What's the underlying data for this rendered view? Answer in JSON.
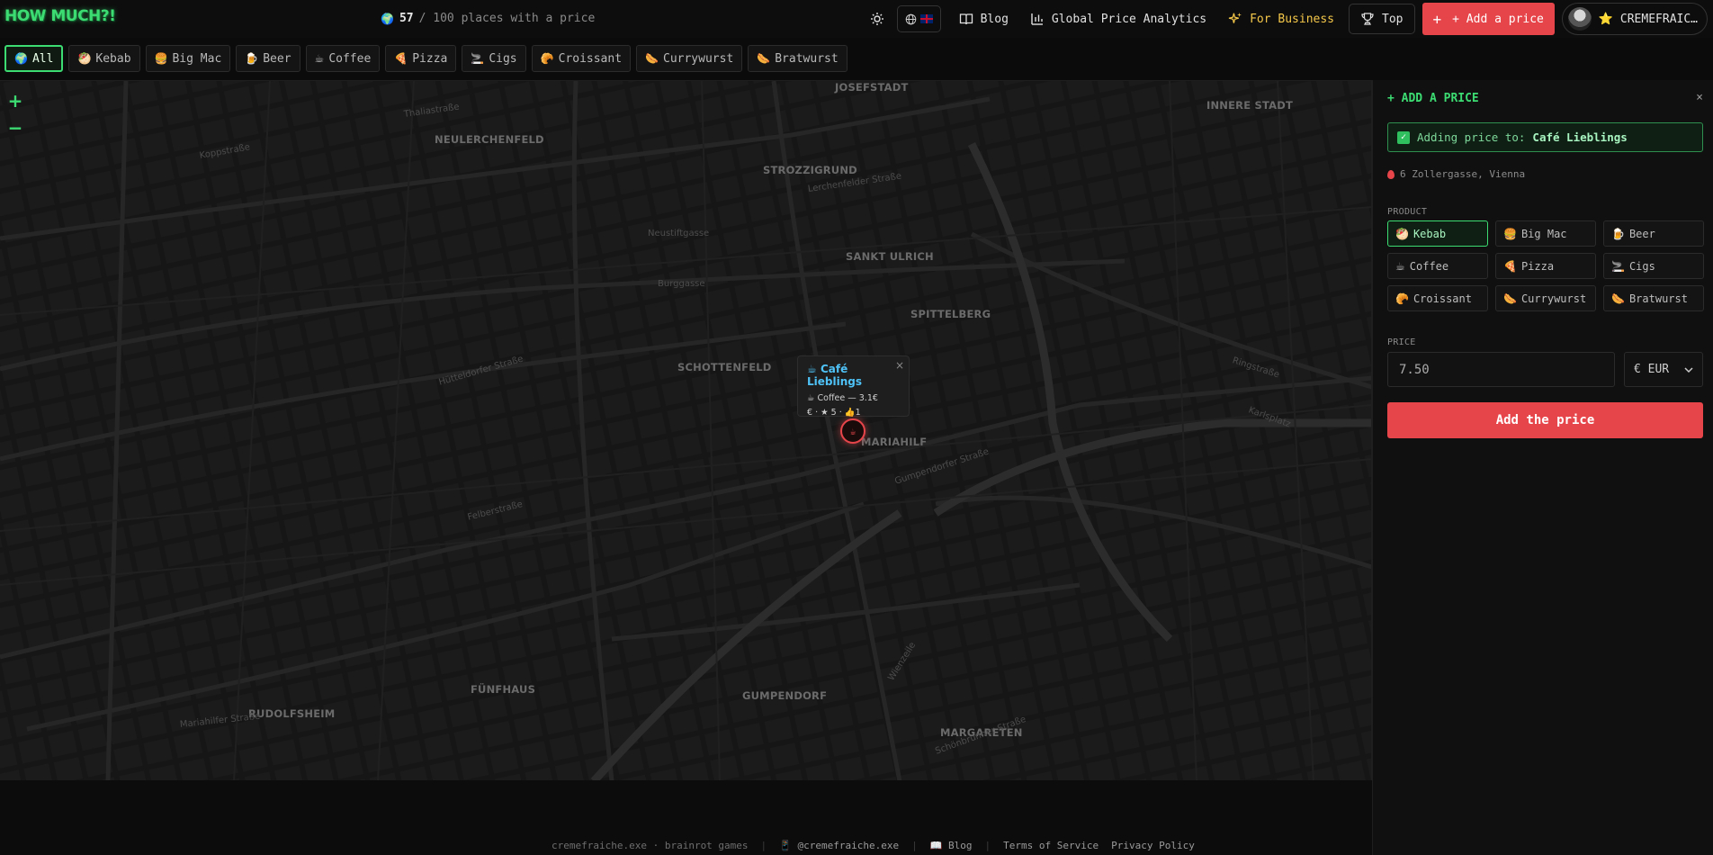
{
  "header": {
    "logo": "HOW MUCH?!",
    "counter_icon": "globe-emoji",
    "counter_value": "57",
    "counter_text": "/ 100 places with a price",
    "theme_icon": "sun-icon",
    "lang_icon": "globe-icon",
    "lang_flag": "uk-flag",
    "nav_blog": "Blog",
    "nav_analytics": "Global Price Analytics",
    "nav_business": "For Business",
    "nav_top": "Top",
    "add_price": "+ Add a price",
    "user_name": "⭐ CREMEFRAIC…"
  },
  "filters": [
    {
      "emoji": "🌍",
      "label": "All",
      "active": true
    },
    {
      "emoji": "🥙",
      "label": "Kebab"
    },
    {
      "emoji": "🍔",
      "label": "Big Mac"
    },
    {
      "emoji": "🍺",
      "label": "Beer"
    },
    {
      "emoji": "☕",
      "label": "Coffee"
    },
    {
      "emoji": "🍕",
      "label": "Pizza"
    },
    {
      "emoji": "🚬",
      "label": "Cigs"
    },
    {
      "emoji": "🥐",
      "label": "Croissant"
    },
    {
      "emoji": "🌭",
      "label": "Currywurst"
    },
    {
      "emoji": "🌭",
      "label": "Bratwurst"
    }
  ],
  "map": {
    "zoom_in": "+",
    "zoom_out": "−",
    "districts": [
      "JOSEFSTADT",
      "INNERE STADT",
      "NEULERCHENFELD",
      "STROZZIGRUND",
      "SANKT ULRICH",
      "SPITTELBERG",
      "SCHOTTENFELD",
      "MARIAHILF",
      "FÜNFHAUS",
      "RUDOLFSHEIM",
      "GUMPENDORF",
      "MARGARETEN"
    ],
    "streets": [
      "Thaliastraße",
      "Koppstraße",
      "Lerchenfelder Straße",
      "Neustiftgasse",
      "Burggasse",
      "Hütteldorfer Straße",
      "Felberstraße",
      "Gumpendorfer Straße",
      "Mariahilfer Straße",
      "Wienzeile",
      "Ringstraße",
      "Karlsplatz",
      "Schönbrunner Straße"
    ],
    "popup": {
      "title": "Café Lieblings",
      "title_emoji": "☕",
      "line1": "☕ Coffee — 3.1€",
      "line2": "€ · ★ 5 · 👍1",
      "close": "×"
    },
    "pin_label": "☕"
  },
  "panel": {
    "title": "+ ADD A PRICE",
    "close": "×",
    "adding_label": "Adding price to:",
    "adding_place": "Café Lieblings",
    "address": "6 Zollergasse, Vienna",
    "product_label": "PRODUCT",
    "products": [
      {
        "emoji": "🥙",
        "label": "Kebab",
        "active": true
      },
      {
        "emoji": "🍔",
        "label": "Big Mac"
      },
      {
        "emoji": "🍺",
        "label": "Beer"
      },
      {
        "emoji": "☕",
        "label": "Coffee"
      },
      {
        "emoji": "🍕",
        "label": "Pizza"
      },
      {
        "emoji": "🚬",
        "label": "Cigs"
      },
      {
        "emoji": "🥐",
        "label": "Croissant"
      },
      {
        "emoji": "🌭",
        "label": "Currywurst"
      },
      {
        "emoji": "🌭",
        "label": "Bratwurst"
      }
    ],
    "price_label": "PRICE",
    "price_placeholder": "7.50",
    "currency": "€ EUR",
    "submit": "Add the price"
  },
  "footer": {
    "credit": "cremefraiche.exe · brainrot games",
    "tiktok": "📱 @cremefraiche.exe",
    "blog": "📖 Blog",
    "terms": "Terms of Service",
    "privacy": "Privacy Policy"
  },
  "colors": {
    "accent": "#3ddc73",
    "danger": "#e6454a",
    "business": "#f5c84a",
    "link": "#4fc3f7"
  }
}
